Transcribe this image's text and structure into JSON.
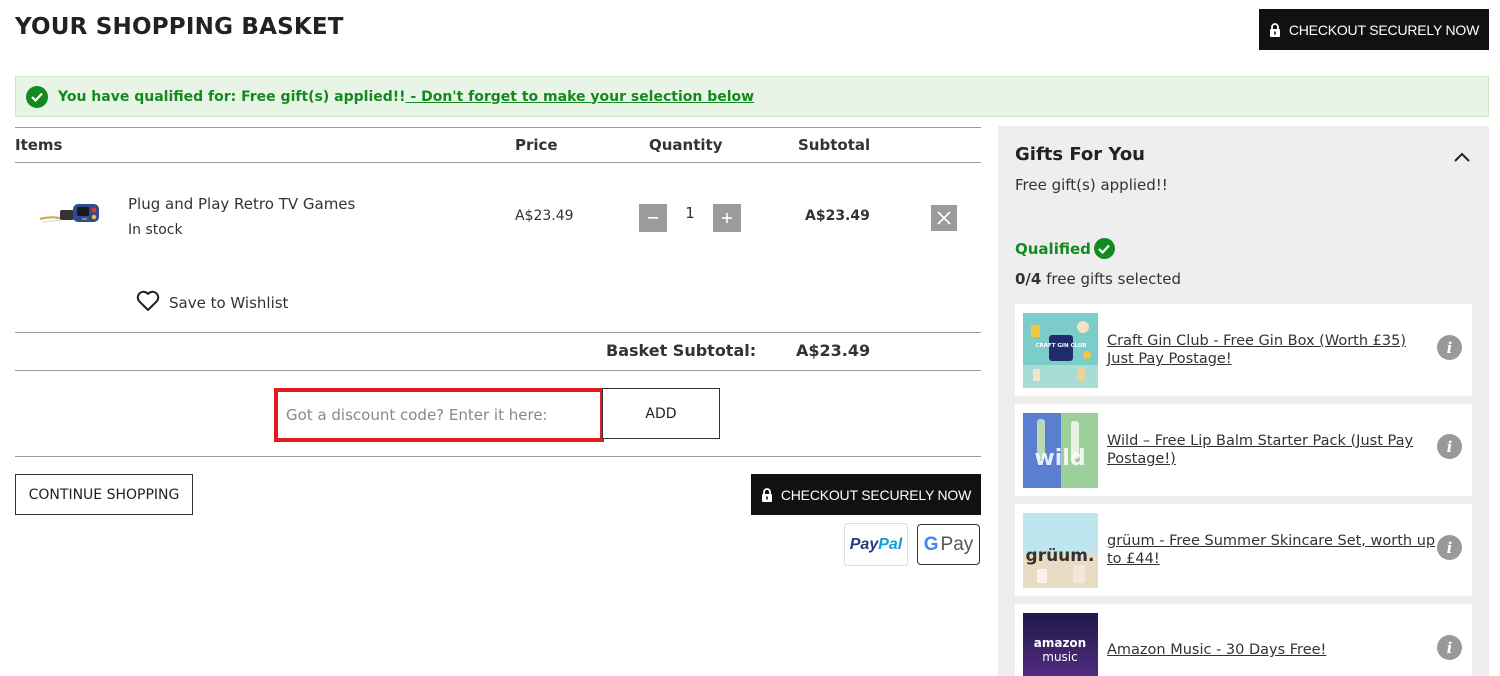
{
  "page": {
    "title": "YOUR SHOPPING BASKET"
  },
  "checkout": {
    "label": "CHECKOUT SECURELY NOW"
  },
  "banner": {
    "qualified_text": "You have qualified for: Free gift(s) applied!!",
    "link_text": " - Don't forget to make your selection below"
  },
  "table": {
    "headers": {
      "items": "Items",
      "price": "Price",
      "quantity": "Quantity",
      "subtotal": "Subtotal"
    }
  },
  "item": {
    "name": "Plug and Play Retro TV Games",
    "stock": "In stock",
    "price": "A$23.49",
    "quantity": "1",
    "subtotal": "A$23.49",
    "wishlist_label": "Save to Wishlist"
  },
  "basket": {
    "subtotal_label": "Basket Subtotal:",
    "subtotal_value": "A$23.49"
  },
  "discount": {
    "placeholder": "Got a discount code? Enter it here:",
    "add_label": "ADD"
  },
  "continue_label": "CONTINUE SHOPPING",
  "payments": {
    "paypal_pay": "Pay",
    "paypal_pal": "Pal",
    "gpay_g": "G",
    "gpay_pay": "Pay"
  },
  "gifts": {
    "title": "Gifts For You",
    "subtitle": "Free gift(s) applied!!",
    "qualified_label": "Qualified",
    "selected_count": "0/4",
    "selected_suffix": " free gifts selected",
    "items": [
      {
        "label": "Craft Gin Club - Free Gin Box (Worth £35) Just Pay Postage!",
        "thumb_text": "CRAFT GIN CLUB"
      },
      {
        "label": "Wild – Free Lip Balm Starter Pack (Just Pay Postage!)",
        "thumb_text": "wild"
      },
      {
        "label": "grüum - Free Summer Skincare Set, worth up to £44!",
        "thumb_text": "grüum."
      },
      {
        "label": "Amazon Music - 30 Days Free!",
        "thumb_text_1": "amazon",
        "thumb_text_2": "music"
      }
    ]
  },
  "colors": {
    "success_green": "#138a1f",
    "banner_bg": "#e7f4e6",
    "highlight_red": "#e21b23",
    "dark_button": "#111111"
  }
}
